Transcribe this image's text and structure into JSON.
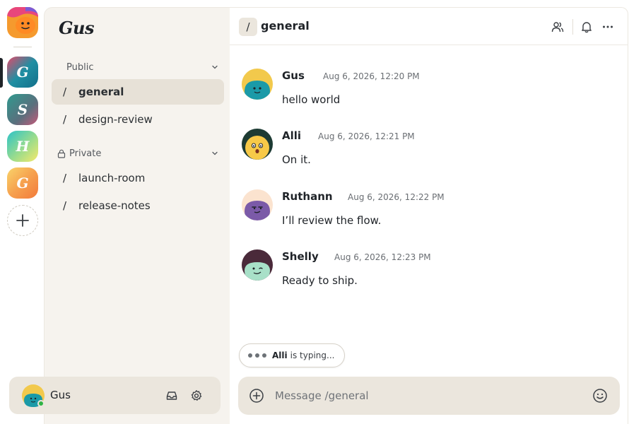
{
  "workspace": {
    "name": "Gus"
  },
  "servers": [
    {
      "letter": "",
      "icon": "gus-logo"
    },
    {
      "letter": "G",
      "active": true
    },
    {
      "letter": "S"
    },
    {
      "letter": "H"
    },
    {
      "letter": "G"
    }
  ],
  "sidebar": {
    "sections": [
      {
        "label": "Public",
        "channels": [
          {
            "name": "general",
            "active": true
          },
          {
            "name": "design-review"
          }
        ]
      },
      {
        "label": "Private",
        "channels": [
          {
            "name": "launch-room"
          },
          {
            "name": "release-notes"
          }
        ]
      }
    ],
    "slash": "/"
  },
  "user": {
    "name": "Gus",
    "status": "online"
  },
  "header": {
    "slash": "/",
    "channel": "general"
  },
  "messages": [
    {
      "author": "Gus",
      "time": "Aug 6, 2026, 12:20 PM",
      "text": "hello world"
    },
    {
      "author": "Alli",
      "time": "Aug 6, 2026, 12:21 PM",
      "text": "On it."
    },
    {
      "author": "Ruthann",
      "time": "Aug 6, 2026, 12:22 PM",
      "text": "I’ll review the flow."
    },
    {
      "author": "Shelly",
      "time": "Aug 6, 2026, 12:23 PM",
      "text": "Ready to ship."
    }
  ],
  "typing": {
    "name": "Alli",
    "text": "is typing..."
  },
  "composer": {
    "placeholder": "Message /general"
  },
  "colors": {
    "sidebar_bg": "#f6f3ee",
    "active_channel": "#e7e1d7",
    "composer_bg": "#ebe6dd",
    "online": "#2fb344"
  }
}
